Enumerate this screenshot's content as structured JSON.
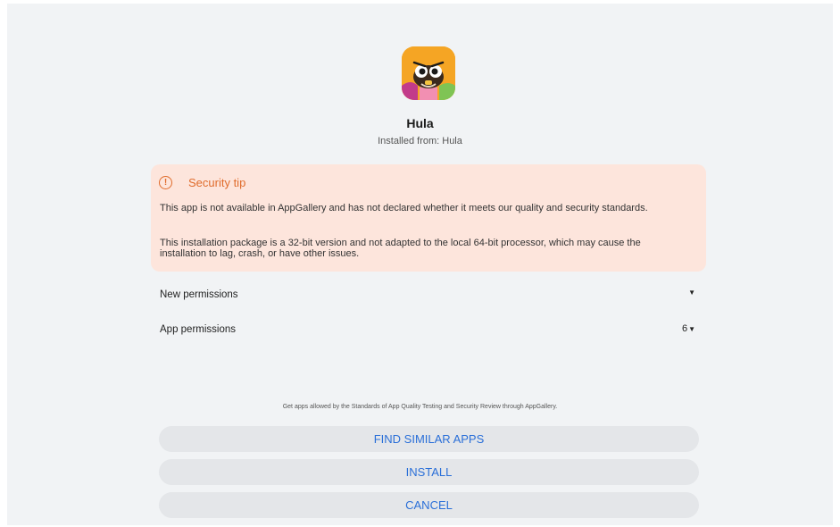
{
  "app": {
    "name": "Hula",
    "installed_from": "Installed from: Hula",
    "icon": "hula-app-icon"
  },
  "security_tip": {
    "icon": "warning-circle-icon",
    "title": "Security tip",
    "paragraph_1": "This app is not available in AppGallery and has not declared whether it meets our quality and security standards.",
    "paragraph_2": "This installation package is a 32-bit version and not adapted to the local 64-bit processor, which may cause the installation to lag, crash, or have other issues.",
    "accent_color": "#e06c2c",
    "background_color": "#fde5dc"
  },
  "permissions": {
    "new_label": "New permissions",
    "app_label": "App permissions",
    "app_count": "6"
  },
  "footnote": "Get apps allowed by the Standards of App Quality Testing and Security Review through AppGallery.",
  "buttons": {
    "find_similar": "FIND SIMILAR APPS",
    "install": "INSTALL",
    "cancel": "CANCEL"
  },
  "colors": {
    "button_text": "#2a6fd8",
    "button_bg": "#e4e6e9",
    "screen_bg": "#f1f3f5"
  }
}
